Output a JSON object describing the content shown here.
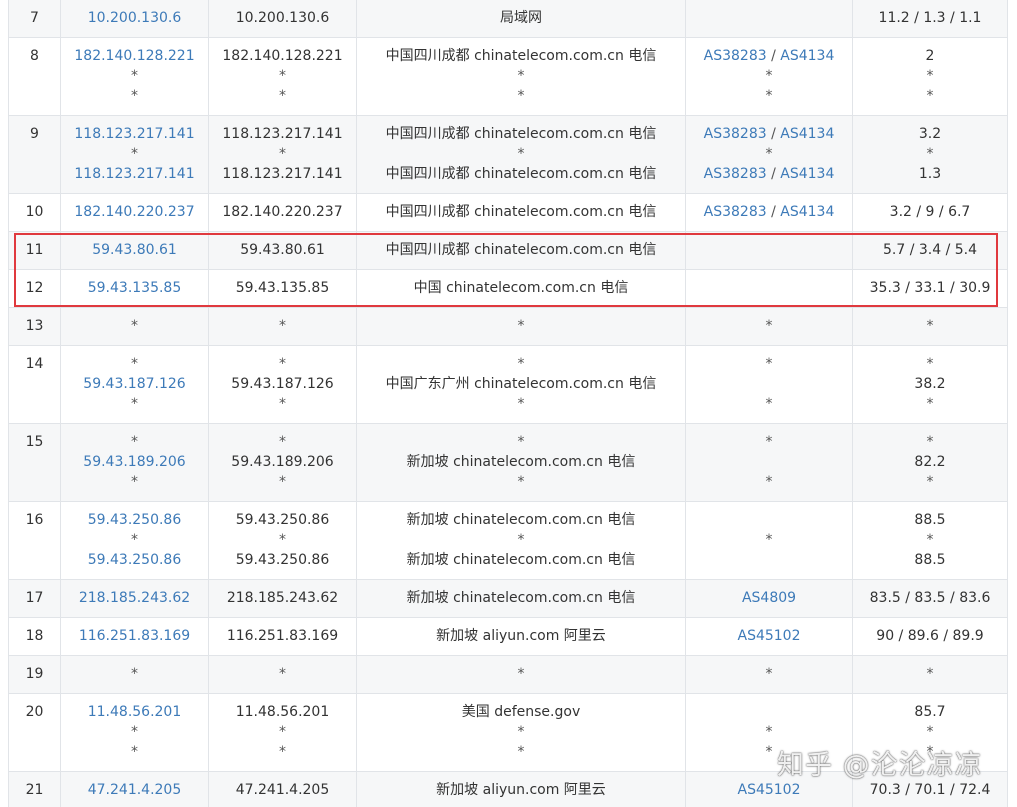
{
  "rows": [
    {
      "hop": "7",
      "ip": [
        "10.200.130.6"
      ],
      "host": [
        "10.200.130.6"
      ],
      "loc": [
        "局域网"
      ],
      "asn": [
        []
      ],
      "time": [
        "11.2 / 1.3 / 1.1"
      ]
    },
    {
      "hop": "8",
      "ip": [
        "182.140.128.221",
        "*",
        "*"
      ],
      "host": [
        "182.140.128.221",
        "*",
        "*"
      ],
      "loc": [
        "中国四川成都 chinatelecom.com.cn 电信",
        "*",
        "*"
      ],
      "asn": [
        [
          "AS38283",
          "AS4134"
        ],
        [
          "*"
        ],
        [
          "*"
        ]
      ],
      "time": [
        "2",
        "*",
        "*"
      ]
    },
    {
      "hop": "9",
      "ip": [
        "118.123.217.141",
        "*",
        "118.123.217.141"
      ],
      "host": [
        "118.123.217.141",
        "*",
        "118.123.217.141"
      ],
      "loc": [
        "中国四川成都 chinatelecom.com.cn 电信",
        "*",
        "中国四川成都 chinatelecom.com.cn 电信"
      ],
      "asn": [
        [
          "AS38283",
          "AS4134"
        ],
        [
          "*"
        ],
        [
          "AS38283",
          "AS4134"
        ]
      ],
      "time": [
        "3.2",
        "*",
        "1.3"
      ]
    },
    {
      "hop": "10",
      "ip": [
        "182.140.220.237"
      ],
      "host": [
        "182.140.220.237"
      ],
      "loc": [
        "中国四川成都 chinatelecom.com.cn 电信"
      ],
      "asn": [
        [
          "AS38283",
          "AS4134"
        ]
      ],
      "time": [
        "3.2 / 9 / 6.7"
      ]
    },
    {
      "hop": "11",
      "ip": [
        "59.43.80.61"
      ],
      "host": [
        "59.43.80.61"
      ],
      "loc": [
        "中国四川成都 chinatelecom.com.cn 电信"
      ],
      "asn": [
        []
      ],
      "time": [
        "5.7 / 3.4 / 5.4"
      ]
    },
    {
      "hop": "12",
      "ip": [
        "59.43.135.85"
      ],
      "host": [
        "59.43.135.85"
      ],
      "loc": [
        "中国 chinatelecom.com.cn 电信"
      ],
      "asn": [
        []
      ],
      "time": [
        "35.3 / 33.1 / 30.9"
      ]
    },
    {
      "hop": "13",
      "ip": [
        "*"
      ],
      "host": [
        "*"
      ],
      "loc": [
        "*"
      ],
      "asn": [
        [
          "*"
        ]
      ],
      "time": [
        "*"
      ]
    },
    {
      "hop": "14",
      "ip": [
        "*",
        "59.43.187.126",
        "*"
      ],
      "host": [
        "*",
        "59.43.187.126",
        "*"
      ],
      "loc": [
        "*",
        "中国广东广州 chinatelecom.com.cn 电信",
        "*"
      ],
      "asn": [
        [
          "*"
        ],
        [],
        [
          "*"
        ]
      ],
      "time": [
        "*",
        "38.2",
        "*"
      ]
    },
    {
      "hop": "15",
      "ip": [
        "*",
        "59.43.189.206",
        "*"
      ],
      "host": [
        "*",
        "59.43.189.206",
        "*"
      ],
      "loc": [
        "*",
        "新加坡 chinatelecom.com.cn 电信",
        "*"
      ],
      "asn": [
        [
          "*"
        ],
        [],
        [
          "*"
        ]
      ],
      "time": [
        "*",
        "82.2",
        "*"
      ]
    },
    {
      "hop": "16",
      "ip": [
        "59.43.250.86",
        "*",
        "59.43.250.86"
      ],
      "host": [
        "59.43.250.86",
        "*",
        "59.43.250.86"
      ],
      "loc": [
        "新加坡 chinatelecom.com.cn 电信",
        "*",
        "新加坡 chinatelecom.com.cn 电信"
      ],
      "asn": [
        [],
        [
          "*"
        ],
        []
      ],
      "time": [
        "88.5",
        "*",
        "88.5"
      ]
    },
    {
      "hop": "17",
      "ip": [
        "218.185.243.62"
      ],
      "host": [
        "218.185.243.62"
      ],
      "loc": [
        "新加坡 chinatelecom.com.cn 电信"
      ],
      "asn": [
        [
          "AS4809"
        ]
      ],
      "time": [
        "83.5 / 83.5 / 83.6"
      ]
    },
    {
      "hop": "18",
      "ip": [
        "116.251.83.169"
      ],
      "host": [
        "116.251.83.169"
      ],
      "loc": [
        "新加坡 aliyun.com 阿里云"
      ],
      "asn": [
        [
          "AS45102"
        ]
      ],
      "time": [
        "90 / 89.6 / 89.9"
      ]
    },
    {
      "hop": "19",
      "ip": [
        "*"
      ],
      "host": [
        "*"
      ],
      "loc": [
        "*"
      ],
      "asn": [
        [
          "*"
        ]
      ],
      "time": [
        "*"
      ]
    },
    {
      "hop": "20",
      "ip": [
        "11.48.56.201",
        "*",
        "*"
      ],
      "host": [
        "11.48.56.201",
        "*",
        "*"
      ],
      "loc": [
        "美国 defense.gov",
        "*",
        "*"
      ],
      "asn": [
        [],
        [
          "*"
        ],
        [
          "*"
        ]
      ],
      "time": [
        "85.7",
        "*",
        "*"
      ]
    },
    {
      "hop": "21",
      "ip": [
        "47.241.4.205"
      ],
      "host": [
        "47.241.4.205"
      ],
      "loc": [
        "新加坡 aliyun.com 阿里云"
      ],
      "asn": [
        [
          "AS45102"
        ]
      ],
      "time": [
        "70.3 / 70.1 / 72.4"
      ]
    }
  ],
  "asn_separator": "/",
  "highlight_color": "#e0393e",
  "link_color": "#3d7ab8",
  "watermark": "知乎 @沦沦凉凉"
}
